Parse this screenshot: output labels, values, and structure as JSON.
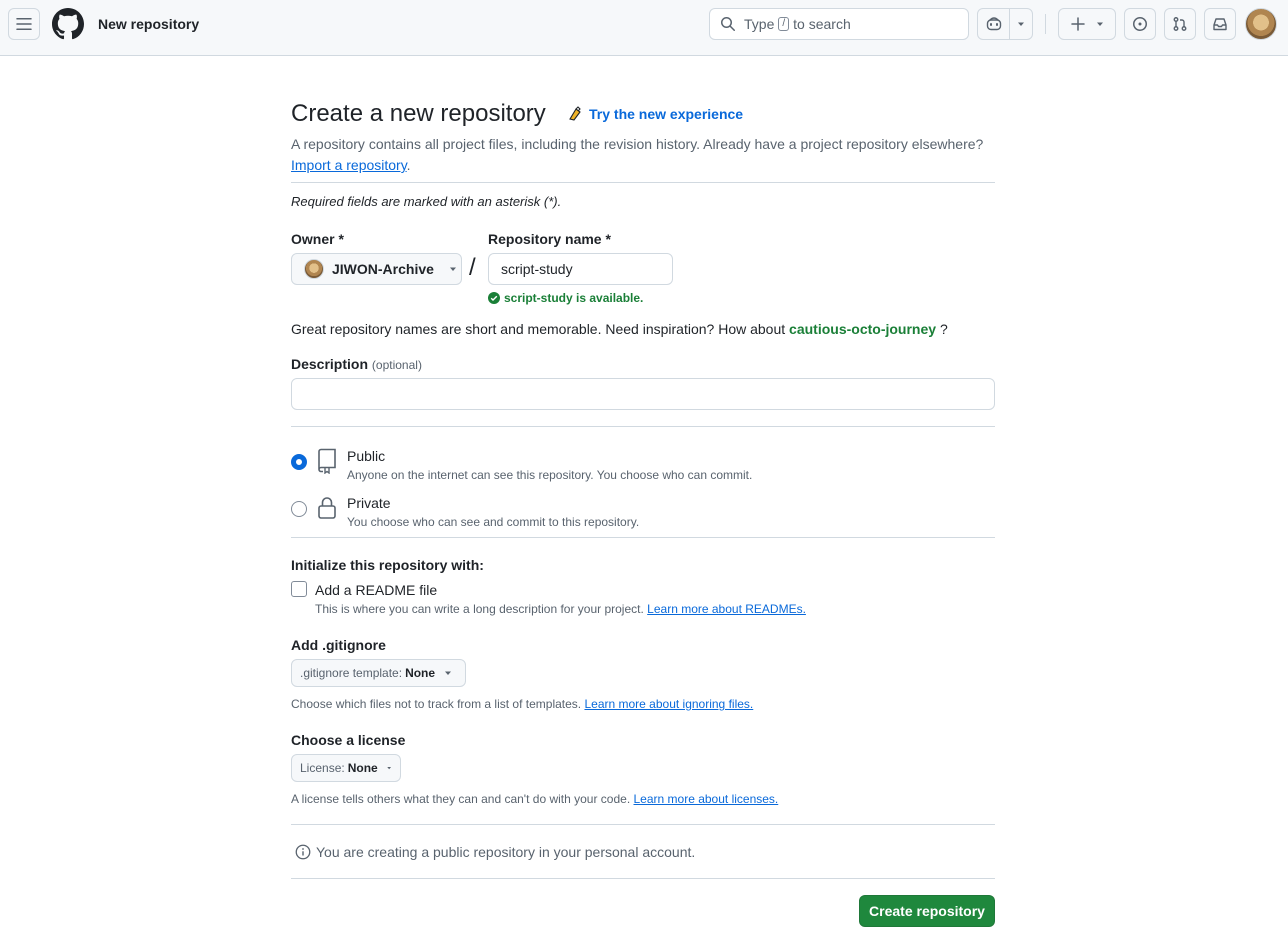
{
  "header": {
    "page_title": "New repository",
    "search": {
      "prefix": "Type",
      "key": "/",
      "suffix": "to search"
    }
  },
  "main": {
    "title": "Create a new repository",
    "try_new": "Try the new experience",
    "intro_text": "A repository contains all project files, including the revision history. Already have a project repository elsewhere?",
    "import_link": "Import a repository",
    "intro_end": ".",
    "required_note": "Required fields are marked with an asterisk (*).",
    "owner": {
      "label": "Owner *",
      "value": "JIWON-Archive"
    },
    "slash": "/",
    "repo_name": {
      "label": "Repository name *",
      "value": "script-study",
      "availability": "script-study is available."
    },
    "suggestion": {
      "text": "Great repository names are short and memorable. Need inspiration? How about",
      "name": "cautious-octo-journey",
      "end": "?"
    },
    "description": {
      "label": "Description",
      "optional": "(optional)",
      "value": ""
    },
    "visibility": [
      {
        "title": "Public",
        "desc": "Anyone on the internet can see this repository. You choose who can commit.",
        "checked": true,
        "icon": "repo-icon"
      },
      {
        "title": "Private",
        "desc": "You choose who can see and commit to this repository.",
        "checked": false,
        "icon": "lock-icon"
      }
    ],
    "init": {
      "heading": "Initialize this repository with:",
      "readme_label": "Add a README file",
      "readme_checked": false,
      "readme_note": "This is where you can write a long description for your project.",
      "readme_link": "Learn more about READMEs."
    },
    "gitignore": {
      "heading": "Add .gitignore",
      "select_prefix": ".gitignore template:",
      "select_value": "None",
      "note": "Choose which files not to track from a list of templates.",
      "link": "Learn more about ignoring files."
    },
    "license": {
      "heading": "Choose a license",
      "select_prefix": "License:",
      "select_value": "None",
      "note": "A license tells others what they can and can't do with your code.",
      "link": "Learn more about licenses."
    },
    "info": "You are creating a public repository in your personal account.",
    "create_button": "Create repository"
  },
  "colors": {
    "accent": "#0969da",
    "success": "#1a7f37",
    "primary_button": "#1f883d"
  }
}
